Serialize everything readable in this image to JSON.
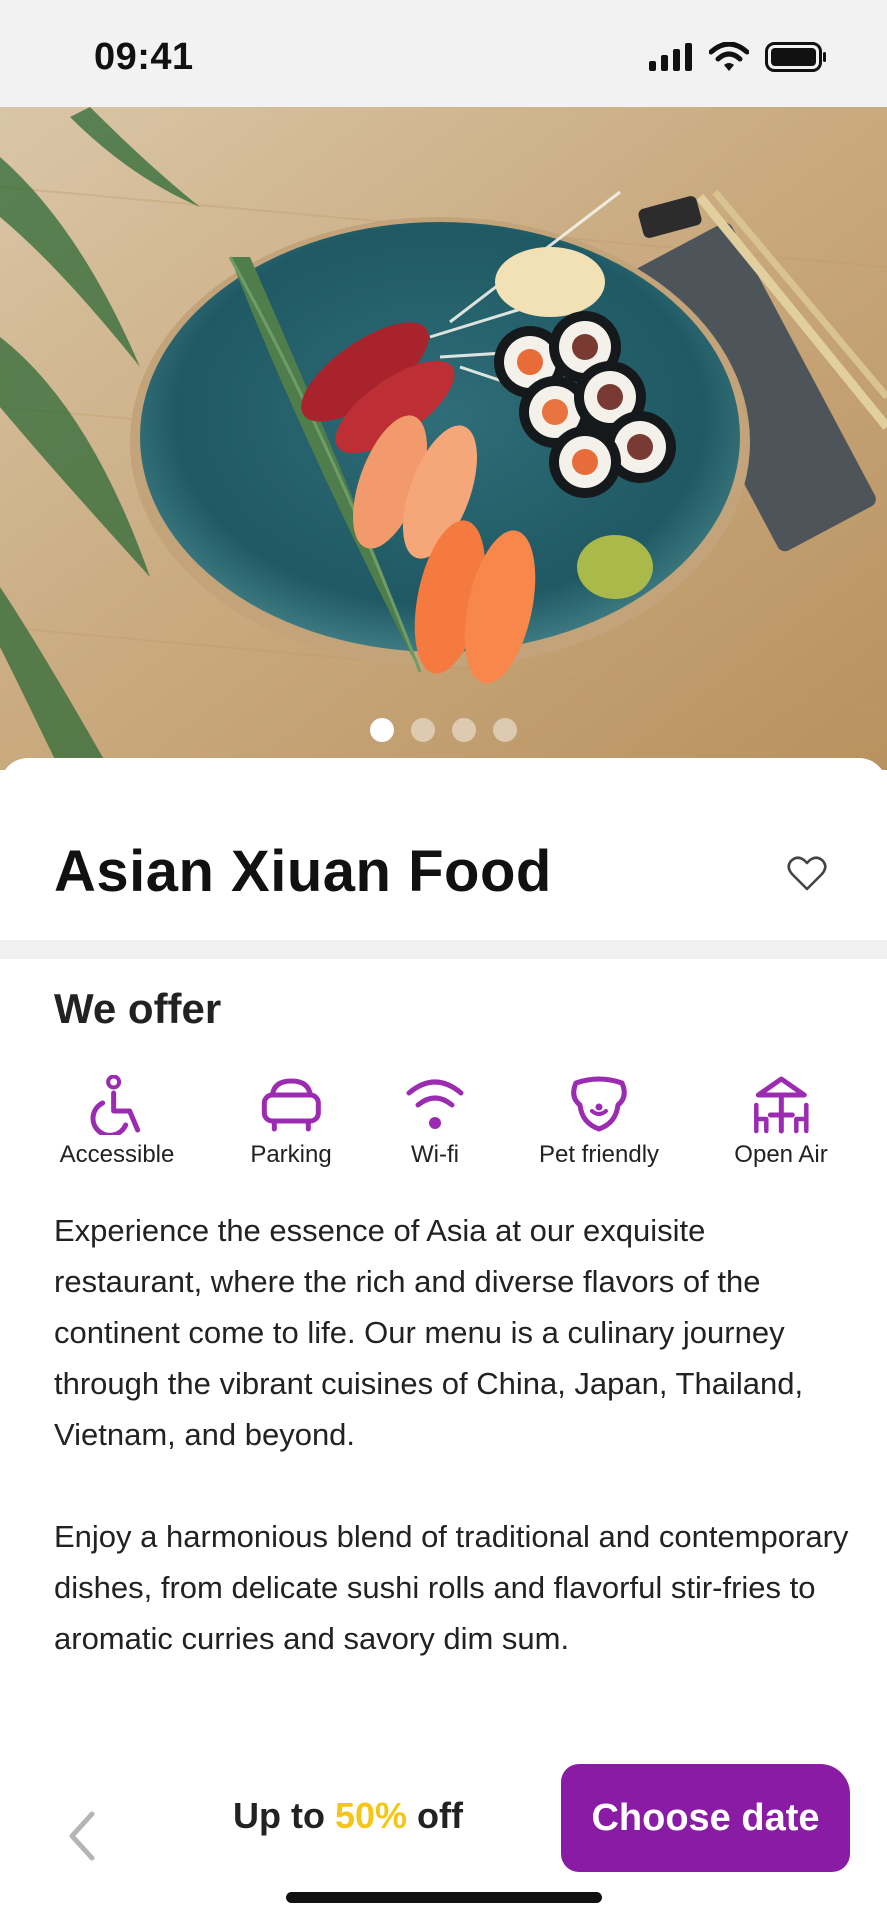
{
  "status_bar": {
    "time": "09:41"
  },
  "gallery": {
    "page_count": 4,
    "active_index": 0
  },
  "restaurant": {
    "name": "Asian Xiuan Food",
    "favorited": false
  },
  "offers": {
    "title": "We offer",
    "items": [
      {
        "label": "Accessible",
        "icon": "wheelchair-icon"
      },
      {
        "label": "Parking",
        "icon": "car-icon"
      },
      {
        "label": "Wi-fi",
        "icon": "wifi-icon"
      },
      {
        "label": "Pet friendly",
        "icon": "dog-icon"
      },
      {
        "label": "Open Air",
        "icon": "terrace-icon"
      }
    ]
  },
  "description": {
    "paragraphs": [
      "Experience the essence of Asia at our exquisite restaurant, where the rich and diverse flavors of the continent come to life. Our menu is a culinary journey through the vibrant cuisines of China, Japan, Thailand, Vietnam, and beyond.",
      "Enjoy a harmonious blend of traditional and contemporary dishes, from delicate sushi rolls and flavorful stir-fries to aromatic curries and savory dim sum."
    ]
  },
  "footer": {
    "promo_prefix": "Up to ",
    "promo_highlight": "50%",
    "promo_suffix": " off",
    "cta_label": "Choose date"
  },
  "colors": {
    "accent": "#8a1ba5",
    "highlight": "#f5c518"
  }
}
